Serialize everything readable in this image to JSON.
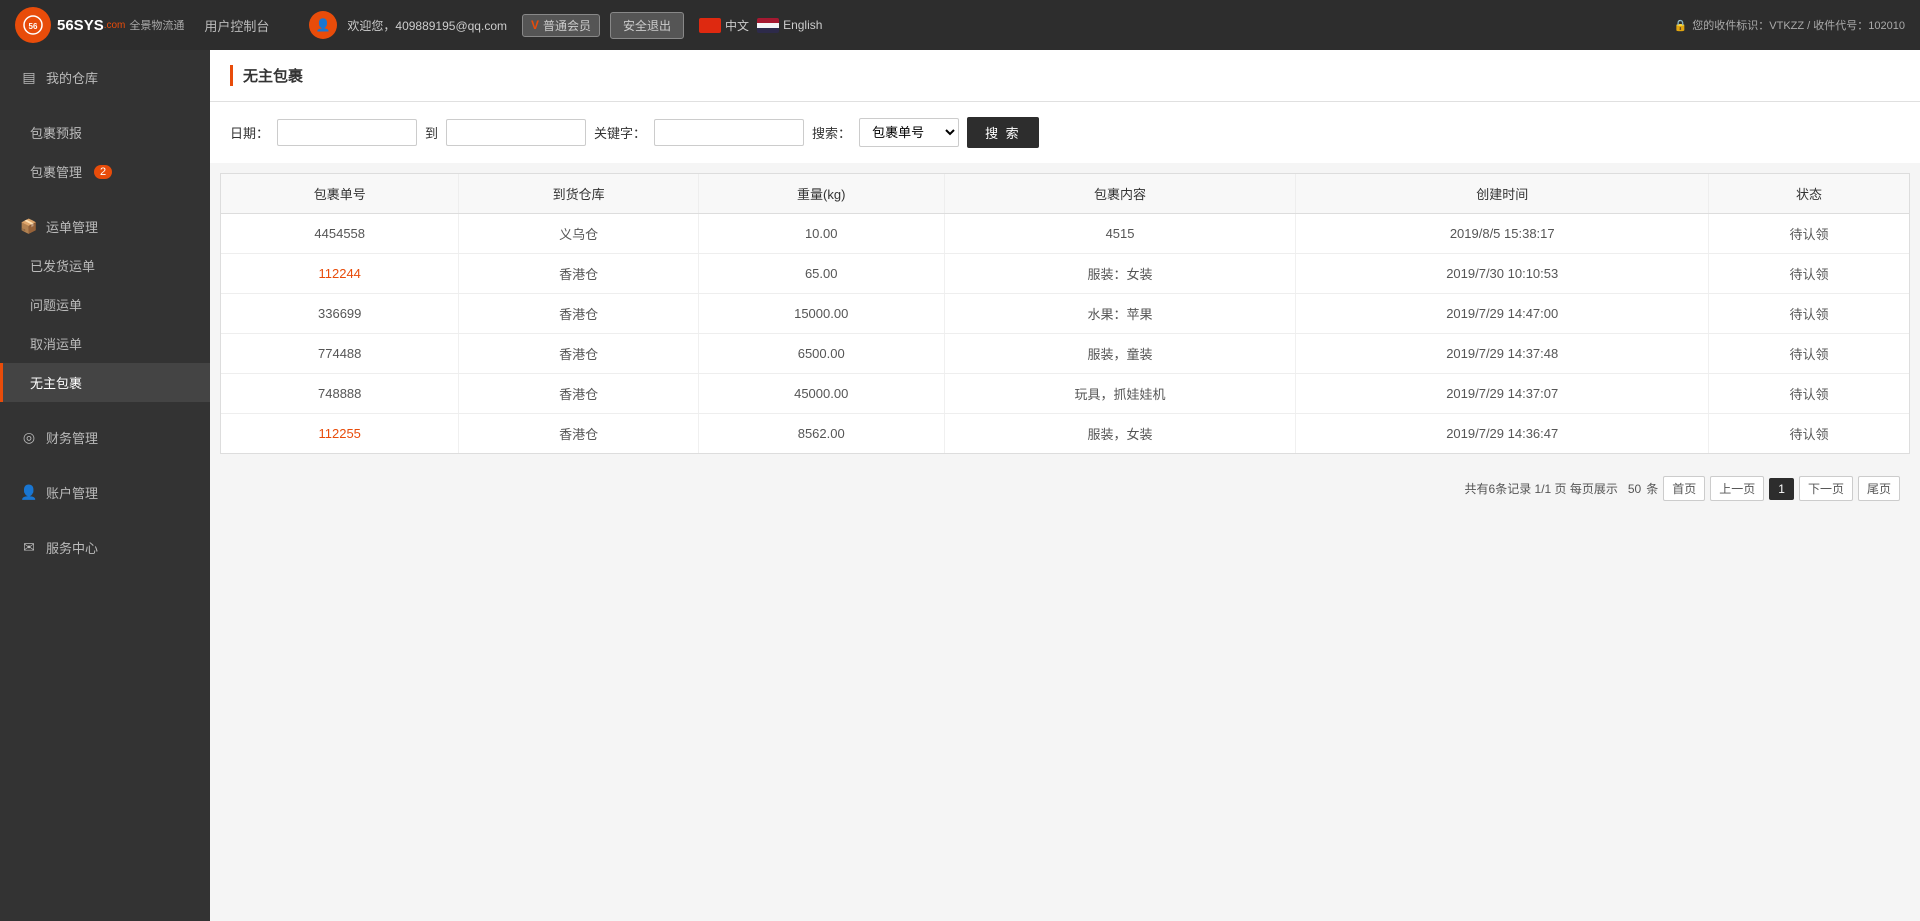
{
  "header": {
    "logo_text": "56SYS",
    "logo_sub": ".com",
    "subtitle": "全景物流通",
    "control_panel": "用户控制台",
    "welcome_text": "欢迎您，409889195@qq.com",
    "member_badge": "普通会员",
    "logout_label": "安全退出",
    "lang_cn": "中文",
    "lang_en": "English",
    "user_id_label": "您的收件标识：VTKZZ / 收件代号：102010"
  },
  "sidebar": {
    "my_warehouse": "我的仓库",
    "package_report": "包裹预报",
    "package_management": "包裹管理",
    "package_badge": "2",
    "shipping_management": "运单管理",
    "shipped_orders": "已发货运单",
    "problem_orders": "问题运单",
    "cancel_orders": "取消运单",
    "ownerless_packages": "无主包裹",
    "finance_management": "财务管理",
    "account_management": "账户管理",
    "service_center": "服务中心"
  },
  "page": {
    "title": "无主包裹",
    "search": {
      "date_label": "日期：",
      "to_label": "到",
      "keyword_label": "关键字：",
      "search_type_label": "搜索：",
      "search_type_value": "包裹单号",
      "search_button": "搜  索",
      "date_from_placeholder": "",
      "date_to_placeholder": "",
      "keyword_placeholder": ""
    },
    "table": {
      "columns": [
        "包裹单号",
        "到货仓库",
        "重量(kg)",
        "包裹内容",
        "创建时间",
        "状态"
      ],
      "rows": [
        {
          "id": "4454558",
          "warehouse": "义乌仓",
          "weight": "10.00",
          "content": "4515",
          "created": "2019/8/5 15:38:17",
          "status": "待认领",
          "link": false
        },
        {
          "id": "112244",
          "warehouse": "香港仓",
          "weight": "65.00",
          "content": "服装：女装",
          "created": "2019/7/30 10:10:53",
          "status": "待认领",
          "link": true
        },
        {
          "id": "336699",
          "warehouse": "香港仓",
          "weight": "15000.00",
          "content": "水果：苹果",
          "created": "2019/7/29 14:47:00",
          "status": "待认领",
          "link": false
        },
        {
          "id": "774488",
          "warehouse": "香港仓",
          "weight": "6500.00",
          "content": "服装，童装",
          "created": "2019/7/29 14:37:48",
          "status": "待认领",
          "link": false
        },
        {
          "id": "748888",
          "warehouse": "香港仓",
          "weight": "45000.00",
          "content": "玩具，抓娃娃机",
          "created": "2019/7/29 14:37:07",
          "status": "待认领",
          "link": false
        },
        {
          "id": "112255",
          "warehouse": "香港仓",
          "weight": "8562.00",
          "content": "服装，女装",
          "created": "2019/7/29 14:36:47",
          "status": "待认领",
          "link": true
        }
      ]
    },
    "pagination": {
      "total_info": "共有6条记录  1/1 页  每页展示",
      "per_page": "50",
      "per_page_unit": "条",
      "first_page": "首页",
      "prev_page": "上一页",
      "current_page": "1",
      "next_page": "下一页",
      "last_page": "尾页"
    }
  }
}
